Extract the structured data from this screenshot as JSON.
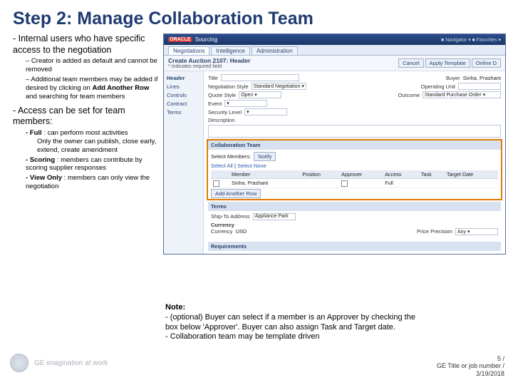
{
  "title": "Step 2: Manage Collaboration Team",
  "left": {
    "p1": "- Internal users who have specific access to the negotiation",
    "s1": "– Creator is added as default and cannot be removed",
    "s2a": "– Additional team members may be added if desired by clicking on ",
    "s2b": "Add Another Row",
    "s2c": " and searching for team members",
    "p2": "- Access can be set for team members:",
    "f_label": "- Full",
    "f_text": " : can perform most activities",
    "f_sub": "Only the owner can publish, close early, extend, create amendment",
    "sc_label": "- Scoring",
    "sc_text": " : members can contribute by scoring supplier responses",
    "vo_label": "- View Only",
    "vo_text": " : members can only view the negotiation"
  },
  "oracle": {
    "brand": "ORACLE",
    "product": "Sourcing",
    "header_right": "■ Navigator ▾   ■ Favorites ▾",
    "tabs": [
      "Negotiations",
      "Intelligence",
      "Administration"
    ],
    "breadcrumb": "Create Auction 2107: Header",
    "required_hint": "* Indicates required field",
    "buttons": {
      "cancel": "Cancel",
      "apply": "Apply Template",
      "online": "Online D"
    },
    "side": [
      "Header",
      "Lines",
      "Controls",
      "Contract Terms"
    ],
    "fields": {
      "title_lbl": "Title",
      "style_lbl": "Negotiation Style",
      "style_val": "Standard Negotiation ▾",
      "qstyle_lbl": "Quote Style",
      "qstyle_val": "Open ▾",
      "event_lbl": "Event",
      "event_val": "▾",
      "sec_lbl": "Security Level",
      "sec_val": "▾",
      "desc_lbl": "Description",
      "buyer_lbl": "Buyer",
      "buyer_val": "Sinha, Prashant",
      "outcome_lbl": "Outcome",
      "outcome_val": "Standard Purchase Order ▾",
      "ou_lbl": "Operating Unit"
    },
    "collab": {
      "bar": "Collaboration Team",
      "select_members": "Select Members:",
      "notify_btn": "Notify",
      "select_all": "Select All",
      "select_none": "Select None",
      "cols": [
        "",
        "Member",
        "Position",
        "Approver",
        "Access",
        "Task",
        "Target Date"
      ],
      "row_member": "Sinha, Prashant",
      "row_access": "Full",
      "add_row": "Add Another Row"
    },
    "terms": {
      "bar": "Terms",
      "ship_lbl": "Ship-To Address",
      "ship_val": "Appliance Park",
      "curr_lbl": "Currency",
      "curr2_lbl": "Currency",
      "curr2_val": "USD",
      "prec_lbl": "Price Precision",
      "prec_val": "Any ▾"
    },
    "req": {
      "bar": "Requirements"
    }
  },
  "note": {
    "h": "Note:",
    "l1": "- (optional) Buyer can select if a member is an Approver by checking the box below 'Approver'. Buyer can also assign Task and Target date.",
    "l2": "- Collaboration team may be template driven"
  },
  "footer": {
    "tagline": "GE imagination at work",
    "page": "5 /",
    "sub": "GE Title or job number /",
    "date": "3/19/2018"
  }
}
